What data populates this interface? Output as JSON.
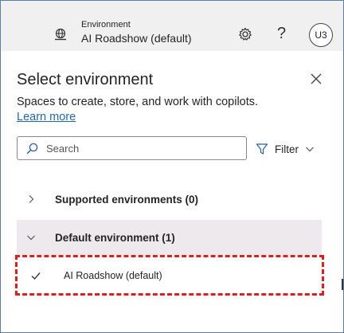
{
  "header": {
    "env_caption": "Environment",
    "env_name": "AI Roadshow (default)",
    "help_label": "?",
    "avatar_initials": "U3"
  },
  "panel": {
    "title": "Select environment",
    "subtitle": "Spaces to create, store, and work with copilots.",
    "learn_more": "Learn more",
    "search_placeholder": "Search",
    "search_value": "",
    "filter_label": "Filter",
    "groups": [
      {
        "label": "Supported environments (0)",
        "expanded": false
      },
      {
        "label": "Default environment (1)",
        "expanded": true
      }
    ],
    "items": [
      {
        "label": "AI Roadshow (default)",
        "selected": true
      }
    ]
  },
  "colors": {
    "topbar": "#f0f0f0",
    "link": "#2167b8",
    "selected_group_bg": "#ede9ed",
    "highlight": "#e31d1d"
  }
}
